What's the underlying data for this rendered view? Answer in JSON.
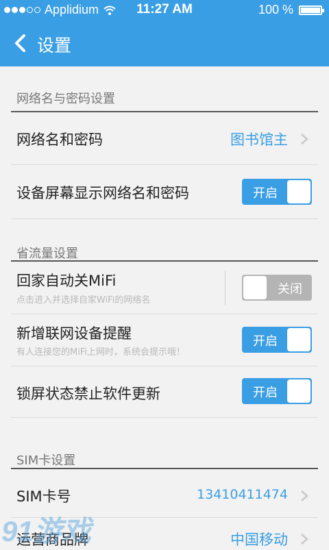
{
  "status_bar": {
    "carrier": "Applidium",
    "time": "11:27 AM",
    "battery_text": "100 %",
    "battery_level": 1.0
  },
  "nav": {
    "title": "设置"
  },
  "sections": {
    "wifi": {
      "title": "网络名与密码设置",
      "network_row": {
        "label": "网络名和密码",
        "value": "图书馆主"
      },
      "display_row": {
        "label": "设备屏幕显示网络名和密码",
        "toggle": "开启",
        "on": true
      }
    },
    "traffic": {
      "title": "省流量设置",
      "auto_off_row": {
        "label": "回家自动关MiFi",
        "sub": "点击进入并选择自家WiFi的网络名",
        "toggle": "关闭",
        "on": false
      },
      "new_device_row": {
        "label": "新增联网设备提醒",
        "sub": "有人连接您的MiFi上网时，系统会提示哦！",
        "toggle": "开启",
        "on": true
      },
      "lock_update_row": {
        "label": "锁屏状态禁止软件更新",
        "toggle": "开启",
        "on": true
      }
    },
    "sim": {
      "title": "SIM卡设置",
      "number_row": {
        "label": "SIM卡号",
        "value": "13410411474"
      },
      "carrier_row": {
        "label": "运营商品牌",
        "value": "中国移动"
      }
    }
  },
  "watermark": "91游戏",
  "colors": {
    "accent": "#3a9ee4",
    "toggle_off": "#b4b4b4",
    "background": "#f2f2f2"
  }
}
